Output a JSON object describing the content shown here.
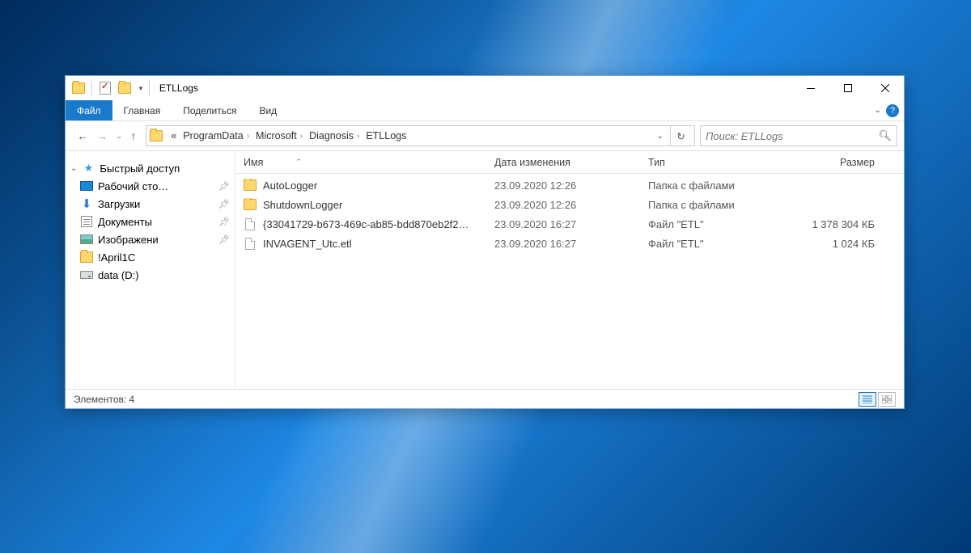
{
  "window": {
    "title": "ETLLogs"
  },
  "ribbon": {
    "file": "Файл",
    "home": "Главная",
    "share": "Поделиться",
    "view": "Вид"
  },
  "breadcrumb": {
    "parts": [
      "ProgramData",
      "Microsoft",
      "Diagnosis",
      "ETLLogs"
    ],
    "prefix": "«"
  },
  "search": {
    "placeholder": "Поиск: ETLLogs"
  },
  "sidebar": {
    "quick_access": "Быстрый доступ",
    "items": [
      {
        "label": "Рабочий сто…",
        "icon": "desktop",
        "pinned": true
      },
      {
        "label": "Загрузки",
        "icon": "downloads",
        "pinned": true
      },
      {
        "label": "Документы",
        "icon": "documents",
        "pinned": true
      },
      {
        "label": "Изображени",
        "icon": "pictures",
        "pinned": true
      },
      {
        "label": "!April1C",
        "icon": "folder",
        "pinned": false
      },
      {
        "label": "data (D:)",
        "icon": "drive",
        "pinned": false
      }
    ]
  },
  "columns": {
    "name": "Имя",
    "date": "Дата изменения",
    "type": "Тип",
    "size": "Размер"
  },
  "files": [
    {
      "name": "AutoLogger",
      "date": "23.09.2020 12:26",
      "type": "Папка с файлами",
      "size": "",
      "icon": "folder"
    },
    {
      "name": "ShutdownLogger",
      "date": "23.09.2020 12:26",
      "type": "Папка с файлами",
      "size": "",
      "icon": "folder"
    },
    {
      "name": "{33041729-b673-469c-ab85-bdd870eb2f2…",
      "date": "23.09.2020 16:27",
      "type": "Файл \"ETL\"",
      "size": "1 378 304 КБ",
      "icon": "file"
    },
    {
      "name": "INVAGENT_Utc.etl",
      "date": "23.09.2020 16:27",
      "type": "Файл \"ETL\"",
      "size": "1 024 КБ",
      "icon": "file"
    }
  ],
  "status": {
    "count_label": "Элементов: 4"
  }
}
